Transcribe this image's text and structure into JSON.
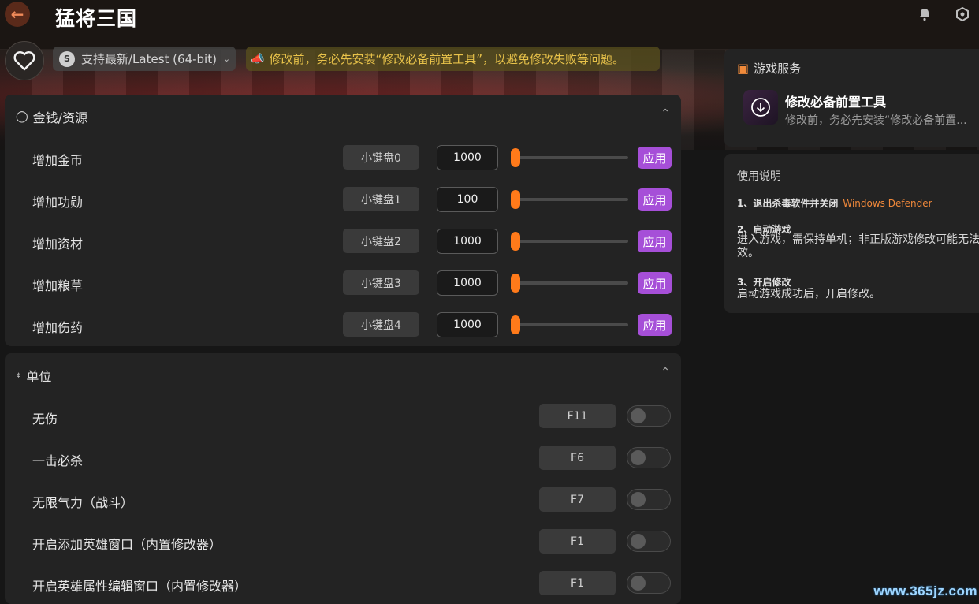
{
  "app": {
    "title": "猛将三国"
  },
  "top_bar": {
    "version_label": "支持最新/Latest (64-bit)",
    "notice": "修改前，务必先安装“修改必备前置工具”，以避免修改失败等问题。"
  },
  "resources": {
    "header": "金钱/资源",
    "apply_label": "应用",
    "items": [
      {
        "label": "增加金币",
        "hotkey": "小键盘0",
        "value": "1000",
        "slider_level": 0
      },
      {
        "label": "增加功勋",
        "hotkey": "小键盘1",
        "value": "100",
        "slider_level": 0
      },
      {
        "label": "增加资材",
        "hotkey": "小键盘2",
        "value": "1000",
        "slider_level": 0
      },
      {
        "label": "增加粮草",
        "hotkey": "小键盘3",
        "value": "1000",
        "slider_level": 0
      },
      {
        "label": "增加伤药",
        "hotkey": "小键盘4",
        "value": "1000",
        "slider_level": 0
      }
    ]
  },
  "units": {
    "header": "单位",
    "items": [
      {
        "label": "无伤",
        "hotkey": "F11",
        "enabled": false
      },
      {
        "label": "一击必杀",
        "hotkey": "F6",
        "enabled": false
      },
      {
        "label": "无限气力（战斗）",
        "hotkey": "F7",
        "enabled": false
      },
      {
        "label": "开启添加英雄窗口（内置修改器）",
        "hotkey": "F1",
        "enabled": false
      },
      {
        "label": "开启英雄属性编辑窗口（内置修改器）",
        "hotkey": "F1",
        "enabled": false
      }
    ]
  },
  "game_service": {
    "title": "游戏服务",
    "item_title": "修改必备前置工具",
    "item_desc": "修改前，务必先安装“修改必备前置..."
  },
  "instructions": {
    "title": "使用说明",
    "step1_title": "1、退出杀毒软件并关闭",
    "step1_highlight": "Windows Defender",
    "step2_title": "2、启动游戏",
    "step2_body_line1": "进入游戏，需保持单机；非正版游戏修改可能无法",
    "step2_body_line2": "效。",
    "step3_title": "3、开启修改",
    "step3_body": "启动游戏成功后，开启修改。"
  },
  "watermark": "www.365jz.com",
  "colors": {
    "accent_purple": "#a64fd8",
    "slider_orange": "#ff7a1a",
    "notice_text": "#e8c24a",
    "highlight_orange": "#f0883a"
  }
}
